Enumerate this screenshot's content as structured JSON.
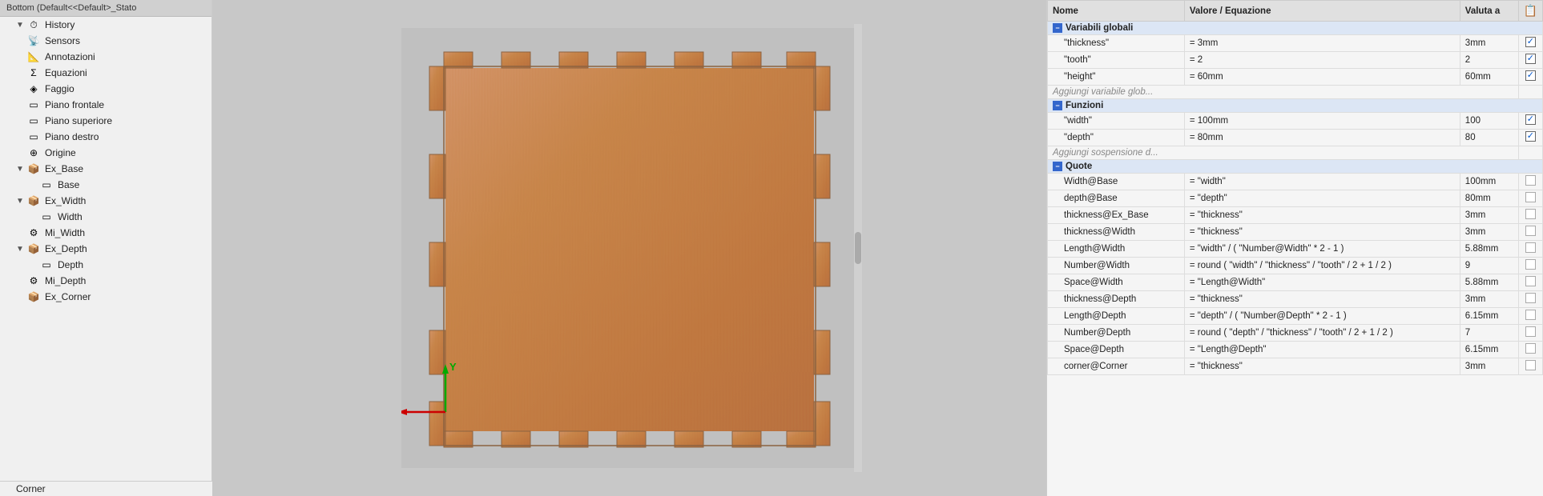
{
  "sidebar": {
    "header": "Bottom  (Default<<Default>_Stato",
    "items": [
      {
        "id": "history",
        "label": "History",
        "indent": 1,
        "arrow": "▼",
        "icon": "🕐"
      },
      {
        "id": "sensors",
        "label": "Sensors",
        "indent": 1,
        "arrow": "",
        "icon": "📡"
      },
      {
        "id": "annotazioni",
        "label": "Annotazioni",
        "indent": 1,
        "arrow": "",
        "icon": "📐"
      },
      {
        "id": "equazioni",
        "label": "Equazioni",
        "indent": 1,
        "arrow": "",
        "icon": "Σ"
      },
      {
        "id": "faggio",
        "label": "Faggio",
        "indent": 1,
        "arrow": "",
        "icon": "🔶"
      },
      {
        "id": "piano-frontale",
        "label": "Piano frontale",
        "indent": 1,
        "arrow": "",
        "icon": "□"
      },
      {
        "id": "piano-superiore",
        "label": "Piano superiore",
        "indent": 1,
        "arrow": "",
        "icon": "□"
      },
      {
        "id": "piano-destro",
        "label": "Piano destro",
        "indent": 1,
        "arrow": "",
        "icon": "□"
      },
      {
        "id": "origine",
        "label": "Origine",
        "indent": 1,
        "arrow": "",
        "icon": "⌖"
      },
      {
        "id": "ex-base",
        "label": "Ex_Base",
        "indent": 1,
        "arrow": "▼",
        "icon": "📦"
      },
      {
        "id": "base",
        "label": "Base",
        "indent": 2,
        "arrow": "",
        "icon": "□"
      },
      {
        "id": "ex-width",
        "label": "Ex_Width",
        "indent": 1,
        "arrow": "▼",
        "icon": "📦"
      },
      {
        "id": "width",
        "label": "Width",
        "indent": 2,
        "arrow": "",
        "icon": "□"
      },
      {
        "id": "mi-width",
        "label": "Mi_Width",
        "indent": 1,
        "arrow": "",
        "icon": "🔧"
      },
      {
        "id": "ex-depth",
        "label": "Ex_Depth",
        "indent": 1,
        "arrow": "▼",
        "icon": "📦"
      },
      {
        "id": "depth",
        "label": "Depth",
        "indent": 2,
        "arrow": "",
        "icon": "□"
      },
      {
        "id": "mi-depth",
        "label": "Mi_Depth",
        "indent": 1,
        "arrow": "",
        "icon": "🔧"
      },
      {
        "id": "ex-corner",
        "label": "Ex_Corner",
        "indent": 1,
        "arrow": "",
        "icon": "📦"
      }
    ],
    "bottom_label": "Corner"
  },
  "table": {
    "headers": {
      "nome": "Nome",
      "valore": "Valore / Equazione",
      "valuta": "Valuta a",
      "icon": "⚙"
    },
    "sections": [
      {
        "id": "global-vars",
        "label": "Variabili globali",
        "rows": [
          {
            "nome": "\"thickness\"",
            "valore": "= 3mm",
            "valuta": "3mm",
            "checked": true
          },
          {
            "nome": "\"tooth\"",
            "valore": "= 2",
            "valuta": "2",
            "checked": true
          },
          {
            "nome": "\"height\"",
            "valore": "= 60mm",
            "valuta": "60mm",
            "checked": true
          },
          {
            "nome": "Aggiungi variabile glob...",
            "valore": "",
            "valuta": "",
            "checked": null,
            "add": true
          }
        ]
      },
      {
        "id": "funzioni",
        "label": "Funzioni",
        "rows": [
          {
            "nome": "\"width\"",
            "valore": "= 100mm",
            "valuta": "100",
            "checked": true
          },
          {
            "nome": "\"depth\"",
            "valore": "= 80mm",
            "valuta": "80",
            "checked": true
          },
          {
            "nome": "Aggiungi sospensione d...",
            "valore": "",
            "valuta": "",
            "checked": null,
            "add": true
          }
        ]
      },
      {
        "id": "quote",
        "label": "Quote",
        "rows": [
          {
            "nome": "Width@Base",
            "valore": "= \"width\"",
            "valuta": "100mm",
            "checked": false
          },
          {
            "nome": "depth@Base",
            "valore": "= \"depth\"",
            "valuta": "80mm",
            "checked": false
          },
          {
            "nome": "thickness@Ex_Base",
            "valore": "= \"thickness\"",
            "valuta": "3mm",
            "checked": false
          },
          {
            "nome": "thickness@Width",
            "valore": "= \"thickness\"",
            "valuta": "3mm",
            "checked": false
          },
          {
            "nome": "Length@Width",
            "valore": "= \"width\" / ( \"Number@Width\" * 2 - 1 )",
            "valuta": "5.88mm",
            "checked": false
          },
          {
            "nome": "Number@Width",
            "valore": "= round ( \"width\" / \"thickness\" / \"tooth\" / 2 + 1 / 2 )",
            "valuta": "9",
            "checked": false
          },
          {
            "nome": "Space@Width",
            "valore": "= \"Length@Width\"",
            "valuta": "5.88mm",
            "checked": false
          },
          {
            "nome": "thickness@Depth",
            "valore": "= \"thickness\"",
            "valuta": "3mm",
            "checked": false
          },
          {
            "nome": "Length@Depth",
            "valore": "= \"depth\" / ( \"Number@Depth\" * 2 - 1 )",
            "valuta": "6.15mm",
            "checked": false
          },
          {
            "nome": "Number@Depth",
            "valore": "= round ( \"depth\" / \"thickness\" / \"tooth\" / 2 + 1 / 2 )",
            "valuta": "7",
            "checked": false
          },
          {
            "nome": "Space@Depth",
            "valore": "= \"Length@Depth\"",
            "valuta": "6.15mm",
            "checked": false
          },
          {
            "nome": "corner@Corner",
            "valore": "= \"thickness\"",
            "valuta": "3mm",
            "checked": false
          }
        ]
      }
    ]
  }
}
